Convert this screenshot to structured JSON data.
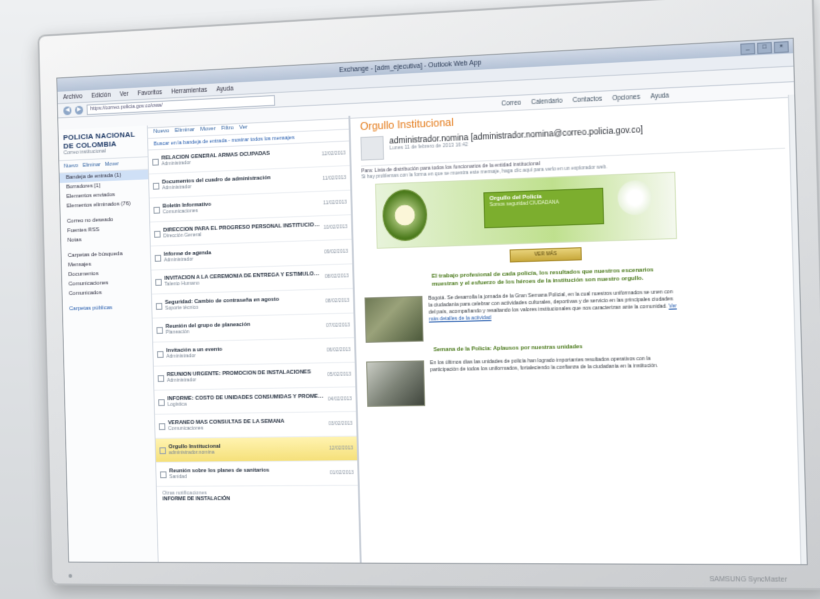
{
  "window": {
    "title": "Exchange - [adm_ejecutiva] - Outlook Web App",
    "controls": [
      "_",
      "□",
      "×"
    ]
  },
  "browser": {
    "menu": [
      "Archivo",
      "Edición",
      "Ver",
      "Favoritos",
      "Herramientas",
      "Ayuda",
      "Archivo",
      "Ver"
    ],
    "url": "https://correo.policia.gov.co/owa/"
  },
  "top_nav": [
    "Correo",
    "Calendario",
    "Contactos",
    "Opciones",
    "Ayuda"
  ],
  "org": {
    "name": "POLICIA NACIONAL DE COLOMBIA",
    "sub": "Correo institucional"
  },
  "folder_tools": [
    "Nuevo",
    "Eliminar",
    "Mover"
  ],
  "folders": [
    {
      "label": "Bandeja de entrada (1)",
      "selected": true
    },
    {
      "label": "Borradores [1]",
      "selected": false
    },
    {
      "label": "Elementos enviados",
      "selected": false
    },
    {
      "label": "Elementos eliminados (76)",
      "selected": false
    },
    {
      "label": "Correo no deseado",
      "selected": false
    },
    {
      "label": "Fuentes RSS",
      "selected": false
    },
    {
      "label": "Notas",
      "selected": false
    },
    {
      "label": "Carpetas de búsqueda",
      "selected": false
    },
    {
      "label": "Mensajes",
      "selected": false
    },
    {
      "label": "Documentos",
      "selected": false
    },
    {
      "label": "Comunicaciones",
      "selected": false
    },
    {
      "label": "Comunicados",
      "selected": false
    }
  ],
  "folder_link": "Carpetas públicas",
  "list": {
    "toolbar": [
      "Nuevo",
      "Eliminar",
      "Mover",
      "Filtro",
      "Ver"
    ],
    "subbar": "Buscar en la bandeja de entrada - mostrar todos los mensajes",
    "messages": [
      {
        "subject": "RELACIÓN GENERAL ARMAS OCUPADAS",
        "from": "Administrador",
        "date": "12/02/2013",
        "selected": false
      },
      {
        "subject": "Documentos del cuadro de administración",
        "from": "Administrador",
        "date": "11/02/2013",
        "selected": false
      },
      {
        "subject": "Boletín Informativo",
        "from": "Comunicaciones",
        "date": "11/02/2013",
        "selected": false
      },
      {
        "subject": "DIRECCIÓN PARA EL PROGRESO PERSONAL INSTITUCIONAL EN SUBMARINOS Y EL...",
        "from": "Dirección General",
        "date": "10/02/2013",
        "selected": false
      },
      {
        "subject": "Informe de agenda",
        "from": "Administrador",
        "date": "09/02/2013",
        "selected": false
      },
      {
        "subject": "INVITACIÓN A LA CEREMONIA DE ENTREGA Y ESTÍMULOS DE ASCENSO PROFESIONALES Y O...",
        "from": "Talento Humano",
        "date": "08/02/2013",
        "selected": false
      },
      {
        "subject": "Seguridad: Cambio de contraseña en agosto",
        "from": "Soporte técnico",
        "date": "08/02/2013",
        "selected": false
      },
      {
        "subject": "Reunión del grupo de planeación",
        "from": "Planeación",
        "date": "07/02/2013",
        "selected": false
      },
      {
        "subject": "Invitación a un evento",
        "from": "Administrador",
        "date": "06/02/2013",
        "selected": false
      },
      {
        "subject": "REUNIÓN URGENTE: PROMOCIÓN DE INSTALACIONES",
        "from": "Administrador",
        "date": "05/02/2013",
        "selected": false
      },
      {
        "subject": "INFORME: COSTO DE UNIDADES CONSUMIDAS Y PROMEDIO DE UTILIZACIÓN EL...",
        "from": "Logística",
        "date": "04/02/2013",
        "selected": false
      },
      {
        "subject": "VERANEO MAS CONSULTAS DE LA SEMANA",
        "from": "Comunicaciones",
        "date": "03/02/2013",
        "selected": false
      },
      {
        "subject": "Orgullo Institucional",
        "from": "administrador.nomina",
        "date": "12/02/2013",
        "selected": true
      },
      {
        "subject": "Reunión sobre los planes de sanitarios",
        "from": "Sanidad",
        "date": "01/02/2013",
        "selected": false
      }
    ],
    "footer_label": "Otras notificaciones",
    "footer_item": "INFORME DE INSTALACIÓN"
  },
  "reading": {
    "subject": "Orgullo Institucional",
    "sender": "administrador.nomina [administrador.nomina@correo.policia.gov.co]",
    "date": "Lunes 11 de febrero de 2013 16:42",
    "to": "Para: Lista de distribución para todos los funcionarios de la entidad institucional",
    "info": "Si hay problemas con la forma en que se muestra este mensaje, haga clic aquí para verlo en un explorador web.",
    "banner_title": "Orgullo del Policía",
    "banner_sub": "Somos seguridad CIUDADANA",
    "button": "VER MÁS",
    "lead": "El trabajo profesional de cada policía, los resultados que nuestros escenarios muestran y el esfuerzo de los héroes de la institución son nuestro orgullo.",
    "article1": "Bogotá. Se desarrolla la jornada de la Gran Semana Policial, en la cual nuestros uniformados se unen con la ciudadanía para celebrar con actividades culturales, deportivas y de servicio en las principales ciudades del país, acompañando y resaltando los valores institucionales que nos caracterizan ante la comunidad.",
    "article1_link": "Ver más detalles de la actividad",
    "subhead": "Semana de la Policía: Aplausos por nuestras unidades",
    "article2": "En los últimos días las unidades de policía han logrado importantes resultados operativos con la participación de todos los uniformados, fortaleciendo la confianza de la ciudadanía en la institución."
  },
  "monitor_label": "SAMSUNG SyncMaster"
}
